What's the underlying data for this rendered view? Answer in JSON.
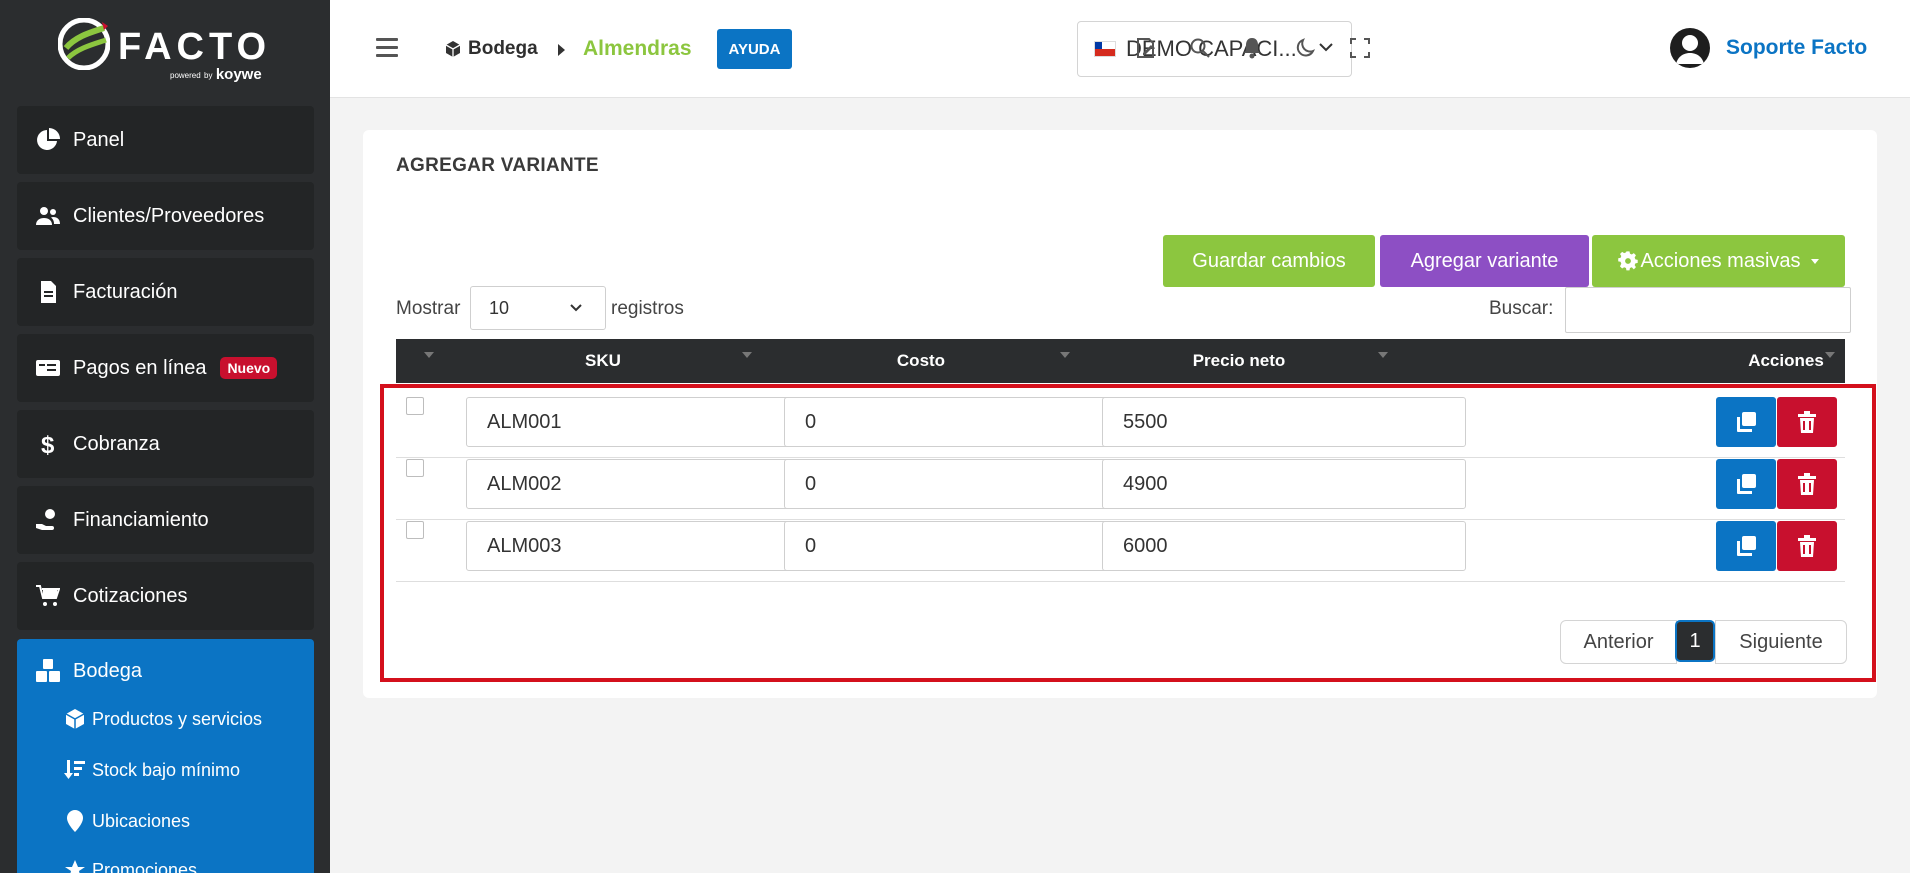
{
  "logo": {
    "brand": "FACTO",
    "powered": "powered",
    "by": "by",
    "vendor": "koywe"
  },
  "sidebar": {
    "items": [
      {
        "label": "Panel",
        "icon": "pie-chart-icon"
      },
      {
        "label": "Clientes/Proveedores",
        "icon": "users-icon"
      },
      {
        "label": "Facturación",
        "icon": "document-icon"
      },
      {
        "label": "Pagos en línea",
        "icon": "payment-card-icon",
        "badge": "Nuevo"
      },
      {
        "label": "Cobranza",
        "icon": "dollar-icon"
      },
      {
        "label": "Financiamiento",
        "icon": "hand-money-icon"
      },
      {
        "label": "Cotizaciones",
        "icon": "cart-icon"
      }
    ],
    "active": {
      "label": "Bodega",
      "icon": "boxes-icon",
      "sub": [
        {
          "label": "Productos y servicios",
          "icon": "box-icon"
        },
        {
          "label": "Stock bajo mínimo",
          "icon": "sort-down-icon"
        },
        {
          "label": "Ubicaciones",
          "icon": "location-pin-icon"
        },
        {
          "label": "Promociones",
          "icon": "star-icon"
        }
      ]
    }
  },
  "topbar": {
    "breadcrumb_parent": "Bodega",
    "breadcrumb_current": "Almendras",
    "help_label": "AYUDA",
    "company": "DEMO CAPACI...",
    "user_name": "Soporte Facto"
  },
  "card": {
    "title": "AGREGAR VARIANTE",
    "buttons": {
      "save": "Guardar cambios",
      "add": "Agregar variante",
      "mass": "Acciones masivas"
    },
    "show_label": "Mostrar",
    "show_value": "10",
    "records_label": "registros",
    "search_label": "Buscar:",
    "search_value": "",
    "columns": {
      "sku": "SKU",
      "cost": "Costo",
      "price": "Precio neto",
      "actions": "Acciones"
    },
    "rows": [
      {
        "sku": "ALM001",
        "cost": "0",
        "price": "5500"
      },
      {
        "sku": "ALM002",
        "cost": "0",
        "price": "4900"
      },
      {
        "sku": "ALM003",
        "cost": "0",
        "price": "6000"
      }
    ],
    "pagination": {
      "prev": "Anterior",
      "page": "1",
      "next": "Siguiente"
    }
  },
  "colors": {
    "brand_green": "#8cc63f",
    "brand_blue": "#0b74c4",
    "purple": "#8d4fc4",
    "danger": "#c8102e",
    "sidebar_bg": "#2b2d2f",
    "highlight": "#d4101c"
  }
}
